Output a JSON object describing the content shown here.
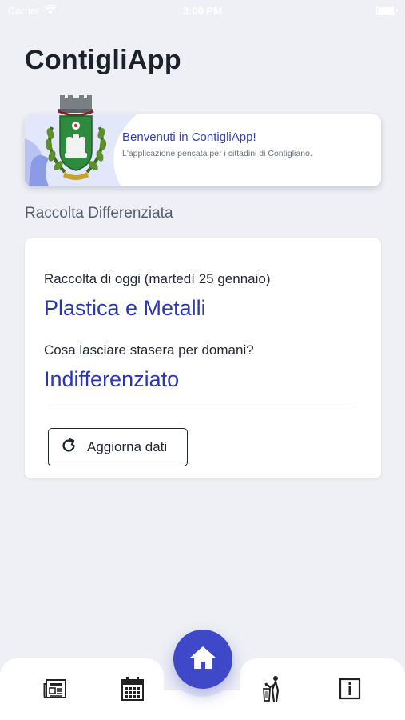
{
  "status_bar": {
    "carrier": "Carrier",
    "time": "3:00 PM",
    "battery_level": 1.0
  },
  "app": {
    "title": "ContigliApp"
  },
  "welcome": {
    "title": "Benvenuti in ContigliApp!",
    "subtitle": "L'applicazione pensata per i cittadini di Contigliano."
  },
  "section": {
    "title": "Raccolta Differenziata"
  },
  "collection": {
    "today_label": "Raccolta di oggi (martedì 25 gennaio)",
    "today_value": "Plastica e Metalli",
    "tomorrow_label": "Cosa lasciare stasera per domani?",
    "tomorrow_value": "Indifferenziato",
    "refresh_label": "Aggiorna dati"
  },
  "nav": {
    "items": [
      {
        "icon": "newspaper-icon"
      },
      {
        "icon": "calendar-icon"
      },
      {
        "icon": "home-icon",
        "active": true
      },
      {
        "icon": "waste-disposal-icon"
      },
      {
        "icon": "info-icon"
      }
    ]
  },
  "colors": {
    "accent": "#3f48c8",
    "value_text": "#2b36b5",
    "background": "#eef0f5"
  }
}
